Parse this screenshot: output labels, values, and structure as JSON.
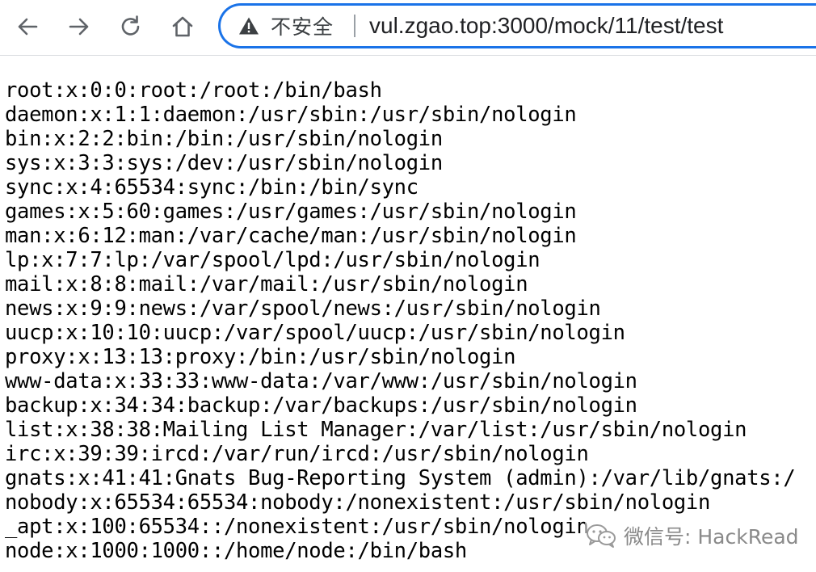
{
  "browser": {
    "security_label": "不安全",
    "url": "vul.zgao.top:3000/mock/11/test/test"
  },
  "content": {
    "lines": [
      "root:x:0:0:root:/root:/bin/bash",
      "daemon:x:1:1:daemon:/usr/sbin:/usr/sbin/nologin",
      "bin:x:2:2:bin:/bin:/usr/sbin/nologin",
      "sys:x:3:3:sys:/dev:/usr/sbin/nologin",
      "sync:x:4:65534:sync:/bin:/bin/sync",
      "games:x:5:60:games:/usr/games:/usr/sbin/nologin",
      "man:x:6:12:man:/var/cache/man:/usr/sbin/nologin",
      "lp:x:7:7:lp:/var/spool/lpd:/usr/sbin/nologin",
      "mail:x:8:8:mail:/var/mail:/usr/sbin/nologin",
      "news:x:9:9:news:/var/spool/news:/usr/sbin/nologin",
      "uucp:x:10:10:uucp:/var/spool/uucp:/usr/sbin/nologin",
      "proxy:x:13:13:proxy:/bin:/usr/sbin/nologin",
      "www-data:x:33:33:www-data:/var/www:/usr/sbin/nologin",
      "backup:x:34:34:backup:/var/backups:/usr/sbin/nologin",
      "list:x:38:38:Mailing List Manager:/var/list:/usr/sbin/nologin",
      "irc:x:39:39:ircd:/var/run/ircd:/usr/sbin/nologin",
      "gnats:x:41:41:Gnats Bug-Reporting System (admin):/var/lib/gnats:/",
      "nobody:x:65534:65534:nobody:/nonexistent:/usr/sbin/nologin",
      "_apt:x:100:65534::/nonexistent:/usr/sbin/nologin",
      "node:x:1000:1000::/home/node:/bin/bash"
    ]
  },
  "watermark": {
    "text": "微信号: HackRead",
    "icon": "wechat-icon"
  },
  "colors": {
    "accent": "#1a73e8",
    "icon": "#5f6368",
    "text": "#000000"
  }
}
